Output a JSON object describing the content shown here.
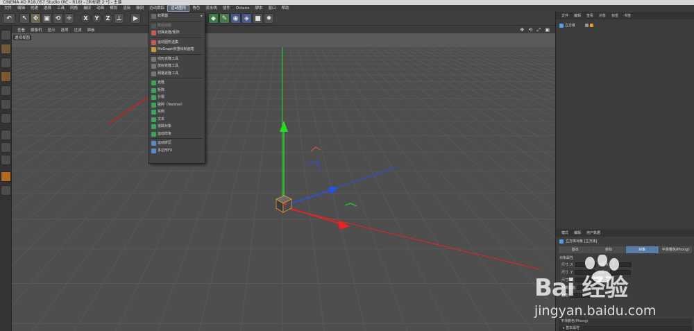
{
  "title": "CINEMA 4D R18.057 Studio (RC - R18) - [未标题 2 *] - 主要",
  "menubar": [
    "文件",
    "编辑",
    "创建",
    "选择",
    "工具",
    "网格",
    "捕捉",
    "动画",
    "模拟",
    "渲染",
    "雕刻",
    "运动跟踪",
    "运动图形",
    "角色",
    "流水线",
    "插件",
    "Octane",
    "脚本",
    "窗口",
    "帮助"
  ],
  "menubar_active_index": 12,
  "viewport_menu": [
    "查看",
    "摄像机",
    "显示",
    "选项",
    "过滤",
    "面板"
  ],
  "viewport_label": "透视视图",
  "viewport_nav": "✥ ⟲ ⤢ ▣",
  "toolbar": {
    "undo": "↶",
    "x": "X",
    "y": "Y",
    "z": "Z"
  },
  "dropdown": [
    {
      "label": "效果器",
      "arrow": "▸",
      "dim": false,
      "color": "#6a6a6a"
    },
    {
      "sep": true
    },
    {
      "label": "群组追踪",
      "dim": true,
      "color": "#555555"
    },
    {
      "label": "切换克隆/矩阵",
      "dim": false,
      "color": "#c85a5a"
    },
    {
      "sep": true
    },
    {
      "label": "运动图形选集",
      "dim": false,
      "color": "#c85a5a"
    },
    {
      "label": "MoGraph权重绘制画笔",
      "dim": false,
      "color": "#c89a3a"
    },
    {
      "sep": true
    },
    {
      "label": "线形克隆工具",
      "dim": false,
      "color": "#777777"
    },
    {
      "label": "放射克隆工具",
      "dim": false,
      "color": "#777777"
    },
    {
      "label": "网格克隆工具",
      "dim": false,
      "color": "#777777"
    },
    {
      "sep": true
    },
    {
      "label": "克隆",
      "dim": false,
      "color": "#3aa55a"
    },
    {
      "label": "矩阵",
      "dim": false,
      "color": "#3aa55a"
    },
    {
      "label": "分裂",
      "dim": false,
      "color": "#3aa55a"
    },
    {
      "label": "破碎（Voronoi）",
      "dim": false,
      "color": "#3aa55a"
    },
    {
      "label": "实例",
      "dim": false,
      "color": "#3aa55a"
    },
    {
      "label": "文本",
      "dim": false,
      "color": "#3aa55a"
    },
    {
      "label": "追踪对象",
      "dim": false,
      "color": "#3aa55a"
    },
    {
      "label": "运动样条",
      "dim": false,
      "color": "#3aa55a"
    },
    {
      "sep": true
    },
    {
      "label": "运动挤压",
      "dim": false,
      "color": "#5a8ac8"
    },
    {
      "label": "多边形FX",
      "dim": false,
      "color": "#5a8ac8"
    }
  ],
  "object_panel": {
    "tabs": [
      "文件",
      "编辑",
      "查看",
      "对象",
      "标签",
      "书签"
    ],
    "object_name": "立方体"
  },
  "attr_panel": {
    "tabs": [
      "模式",
      "编辑",
      "用户数据"
    ],
    "title": "立方体对象 [立方体]",
    "subtabs": [
      "基本",
      "坐标",
      "对象",
      "平滑着色(Phong)"
    ],
    "active_subtab": 2,
    "section": "对象属性",
    "rows": [
      {
        "label": "尺寸 .X",
        "value": "",
        "seg_label": "分段 X",
        "seg_value": "1"
      },
      {
        "label": "尺寸 .Y",
        "value": "",
        "seg_label": "分段 Y",
        "seg_value": ""
      },
      {
        "label": "尺寸 .Z",
        "value": "",
        "seg_label": "",
        "seg_value": ""
      },
      {
        "label": "分离表面",
        "value": "",
        "seg_label": "",
        "seg_value": ""
      },
      {
        "label": "圆角",
        "value": "",
        "seg_label": "",
        "seg_value": ""
      }
    ],
    "footer": "平滑着色(Phong)",
    "footer2": "▸ 基本属性"
  },
  "watermark": {
    "brand": "Bai 经验",
    "url": "jingyan.baidu.com"
  },
  "colors": {
    "axis_y": "#22dd22",
    "axis_x": "#ee2222",
    "axis_z": "#2255ee",
    "grid": "#5a5a5a",
    "highlight": "#5a7ca8"
  }
}
